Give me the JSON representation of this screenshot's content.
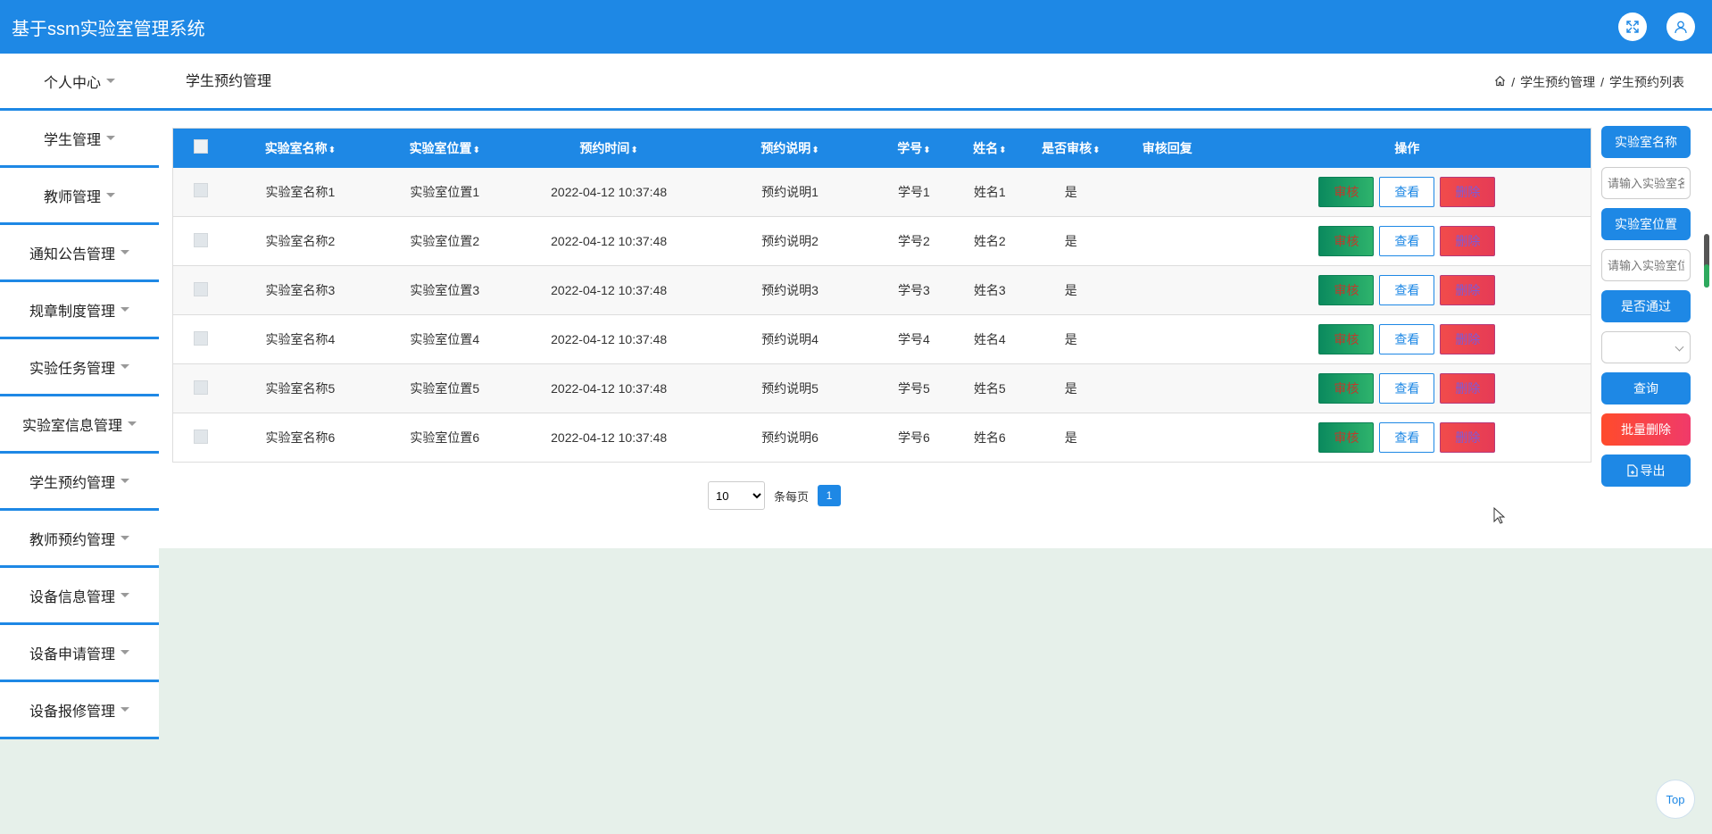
{
  "app": {
    "title": "基于ssm实验室管理系统"
  },
  "topbar": {
    "fullscreen_icon": "expand-icon",
    "user_icon": "user-icon"
  },
  "header": {
    "page_title": "学生预约管理",
    "breadcrumb": [
      "学生预约管理",
      "学生预约列表"
    ],
    "sep": "/"
  },
  "sidebar": {
    "items": [
      {
        "label": "个人中心"
      },
      {
        "label": "学生管理"
      },
      {
        "label": "教师管理"
      },
      {
        "label": "通知公告管理"
      },
      {
        "label": "规章制度管理"
      },
      {
        "label": "实验任务管理"
      },
      {
        "label": "实验室信息管理"
      },
      {
        "label": "学生预约管理"
      },
      {
        "label": "教师预约管理"
      },
      {
        "label": "设备信息管理"
      },
      {
        "label": "设备申请管理"
      },
      {
        "label": "设备报修管理"
      }
    ]
  },
  "table": {
    "headers": [
      "实验室名称",
      "实验室位置",
      "预约时间",
      "预约说明",
      "学号",
      "姓名",
      "是否审核",
      "审核回复",
      "操作"
    ],
    "sort_glyph": "⬍",
    "rows": [
      {
        "name": "实验室名称1",
        "location": "实验室位置1",
        "time": "2022-04-12 10:37:48",
        "desc": "预约说明1",
        "sid": "学号1",
        "sname": "姓名1",
        "audited": "是",
        "reply": ""
      },
      {
        "name": "实验室名称2",
        "location": "实验室位置2",
        "time": "2022-04-12 10:37:48",
        "desc": "预约说明2",
        "sid": "学号2",
        "sname": "姓名2",
        "audited": "是",
        "reply": ""
      },
      {
        "name": "实验室名称3",
        "location": "实验室位置3",
        "time": "2022-04-12 10:37:48",
        "desc": "预约说明3",
        "sid": "学号3",
        "sname": "姓名3",
        "audited": "是",
        "reply": ""
      },
      {
        "name": "实验室名称4",
        "location": "实验室位置4",
        "time": "2022-04-12 10:37:48",
        "desc": "预约说明4",
        "sid": "学号4",
        "sname": "姓名4",
        "audited": "是",
        "reply": ""
      },
      {
        "name": "实验室名称5",
        "location": "实验室位置5",
        "time": "2022-04-12 10:37:48",
        "desc": "预约说明5",
        "sid": "学号5",
        "sname": "姓名5",
        "audited": "是",
        "reply": ""
      },
      {
        "name": "实验室名称6",
        "location": "实验室位置6",
        "time": "2022-04-12 10:37:48",
        "desc": "预约说明6",
        "sid": "学号6",
        "sname": "姓名6",
        "audited": "是",
        "reply": ""
      }
    ],
    "actions": {
      "audit": "审核",
      "view": "查看",
      "delete": "删除"
    }
  },
  "pager": {
    "page_size": "10",
    "page_size_options": [
      "10"
    ],
    "per_page_label": "条每页",
    "current_page": "1"
  },
  "search": {
    "lab_name_label": "实验室名称",
    "lab_name_placeholder": "请输入实验室名称",
    "lab_location_label": "实验室位置",
    "lab_location_placeholder": "请输入实验室位置",
    "passed_label": "是否通过",
    "passed_value": "",
    "query_label": "查询",
    "batch_delete_label": "批量删除",
    "export_label": "导出"
  },
  "top_button": {
    "label": "Top"
  },
  "colors": {
    "primary": "#1e88e5",
    "audit": "#0b8a5e",
    "delete": "#f14b4b",
    "background": "#e6f0ea"
  }
}
